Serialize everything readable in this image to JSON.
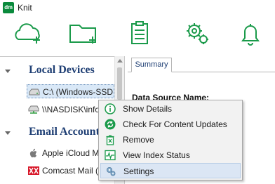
{
  "app": {
    "logo_text": "dm",
    "title": "Knit",
    "accent_color": "#0a8a3c"
  },
  "toolbar": {
    "buttons": [
      {
        "icon": "cloud-add-icon"
      },
      {
        "icon": "folder-add-icon"
      },
      {
        "icon": "clipboard-list-icon"
      },
      {
        "icon": "gears-icon"
      },
      {
        "icon": "bell-icon"
      }
    ]
  },
  "sidebar": {
    "groups": [
      {
        "label": "Local Devices",
        "items": [
          {
            "label": "C:\\ (Windows-SSD@",
            "icon": "drive-icon",
            "selected": true
          },
          {
            "label": "\\\\NASDISK\\info",
            "icon": "network-drive-icon",
            "selected": false
          }
        ]
      },
      {
        "label": "Email Account",
        "items": [
          {
            "label": "Apple iCloud Mail",
            "icon": "apple-icon",
            "selected": false
          },
          {
            "label": "Comcast Mail (jo",
            "icon": "comcast-mail-icon",
            "selected": false
          }
        ]
      }
    ]
  },
  "main": {
    "tabs": [
      {
        "label": "Summary",
        "active": true
      }
    ],
    "data_source_label": "Data Source Name:"
  },
  "context_menu": {
    "items": [
      {
        "label": "Show Details",
        "icon": "info-icon"
      },
      {
        "label": "Check For Content Updates",
        "icon": "refresh-icon"
      },
      {
        "label": "Remove",
        "icon": "trash-icon"
      },
      {
        "label": "View Index Status",
        "icon": "activity-icon"
      },
      {
        "label": "Settings",
        "icon": "settings-icon",
        "highlighted": true
      }
    ]
  }
}
